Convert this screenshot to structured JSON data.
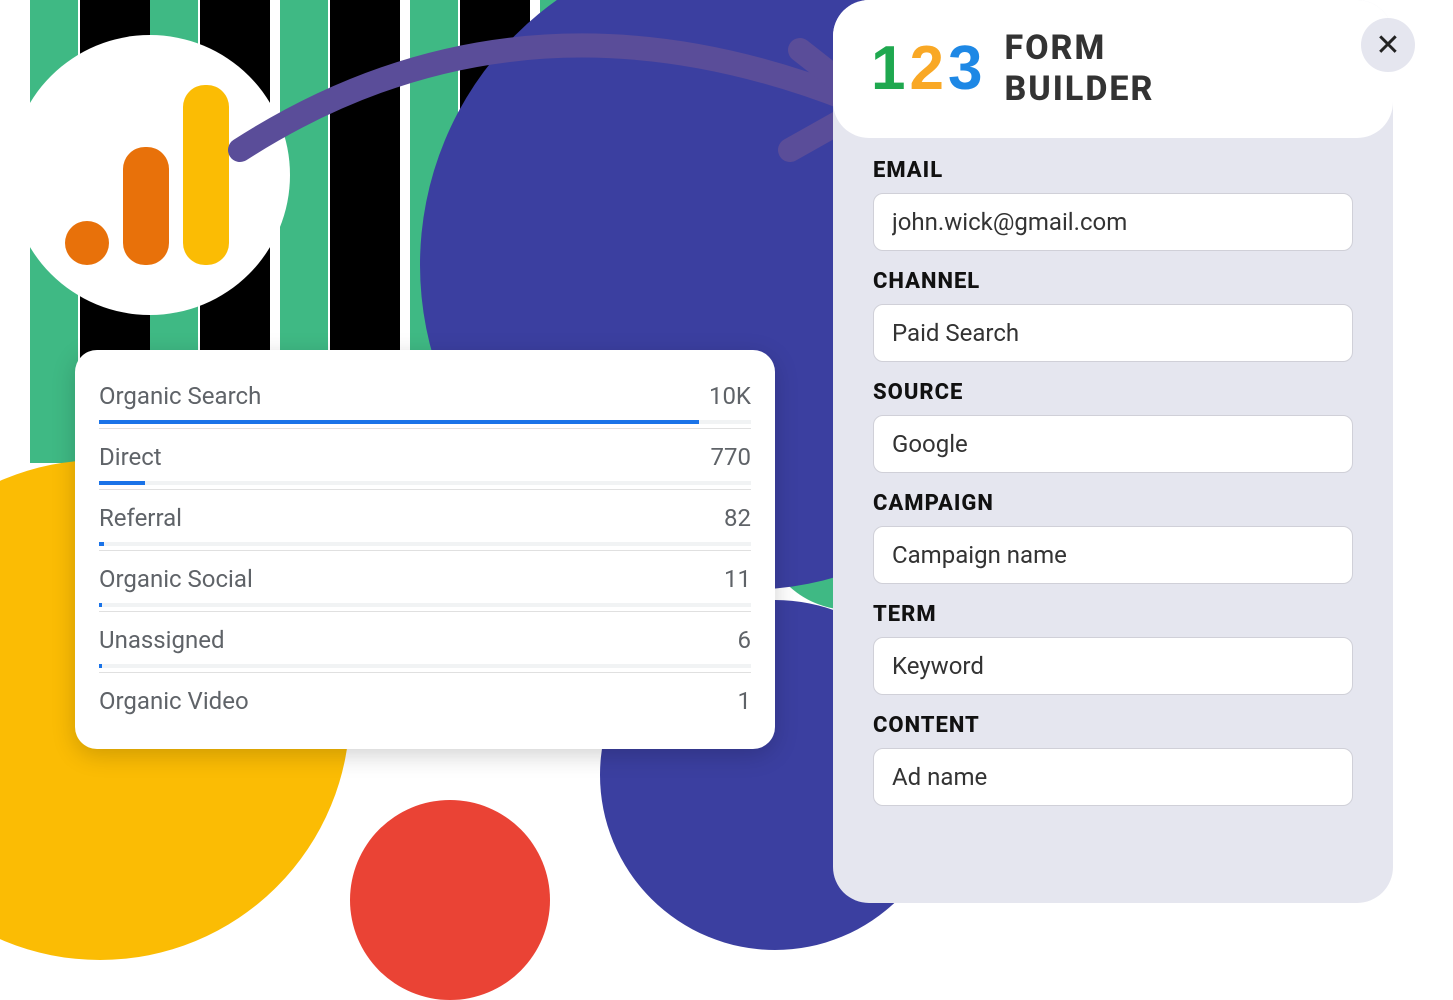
{
  "form_builder": {
    "logo_digits": [
      "1",
      "2",
      "3"
    ],
    "title_line1": "FORM",
    "title_line2": "BUILDER",
    "close_icon": "✕",
    "fields": [
      {
        "label": "EMAIL",
        "value": "john.wick@gmail.com"
      },
      {
        "label": "CHANNEL",
        "value": "Paid Search"
      },
      {
        "label": "SOURCE",
        "value": "Google"
      },
      {
        "label": "CAMPAIGN",
        "value": "Campaign name"
      },
      {
        "label": "TERM",
        "value": "Keyword"
      },
      {
        "label": "CONTENT",
        "value": "Ad name"
      }
    ]
  },
  "chart_data": {
    "type": "bar",
    "title": "",
    "categories": [
      "Organic Search",
      "Direct",
      "Referral",
      "Organic Social",
      "Unassigned",
      "Organic Video"
    ],
    "values_display": [
      "10K",
      "770",
      "82",
      "11",
      "6",
      "1"
    ],
    "values": [
      10000,
      770,
      82,
      11,
      6,
      1
    ],
    "xlabel": "",
    "ylabel": "",
    "max": 10000
  }
}
